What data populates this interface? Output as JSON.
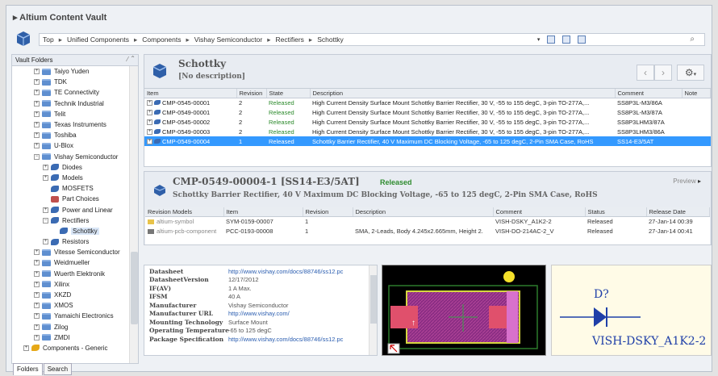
{
  "app": {
    "title": "Altium Content Vault"
  },
  "breadcrumb": [
    "Top",
    "Unified Components",
    "Components",
    "Vishay Semiconductor",
    "Rectifiers",
    "Schottky"
  ],
  "sidebar": {
    "header": "Vault Folders",
    "items": [
      {
        "label": "Taiyo Yuden",
        "icon": "folder-icon",
        "level": 1,
        "exp": "+"
      },
      {
        "label": "TDK",
        "icon": "folder-icon",
        "level": 1,
        "exp": "+"
      },
      {
        "label": "TE Connectivity",
        "icon": "folder-icon",
        "level": 1,
        "exp": "+"
      },
      {
        "label": "Technik Industrial",
        "icon": "folder-icon",
        "level": 1,
        "exp": "+"
      },
      {
        "label": "Telit",
        "icon": "folder-icon",
        "level": 1,
        "exp": "+"
      },
      {
        "label": "Texas Instruments",
        "icon": "folder-icon",
        "level": 1,
        "exp": "+"
      },
      {
        "label": "Toshiba",
        "icon": "folder-icon",
        "level": 1,
        "exp": "+"
      },
      {
        "label": "U-Blox",
        "icon": "folder-icon",
        "level": 1,
        "exp": "+"
      },
      {
        "label": "Vishay Semiconductor",
        "icon": "folder-icon",
        "level": 1,
        "exp": "-"
      },
      {
        "label": "Diodes",
        "icon": "component-icon",
        "level": 2,
        "exp": "+"
      },
      {
        "label": "Models",
        "icon": "component-icon",
        "level": 2,
        "exp": "+"
      },
      {
        "label": "MOSFETS",
        "icon": "component-icon",
        "level": 2,
        "exp": ""
      },
      {
        "label": "Part Choices",
        "icon": "part-choice-icon",
        "level": 2,
        "exp": ""
      },
      {
        "label": "Power and Linear",
        "icon": "component-icon",
        "level": 2,
        "exp": "+"
      },
      {
        "label": "Rectifiers",
        "icon": "component-icon",
        "level": 2,
        "exp": "-"
      },
      {
        "label": "Schottky",
        "icon": "component-icon",
        "level": 3,
        "exp": "",
        "selected": true
      },
      {
        "label": "Resistors",
        "icon": "component-icon",
        "level": 2,
        "exp": "+"
      },
      {
        "label": "Vitesse Semiconductor",
        "icon": "folder-icon",
        "level": 1,
        "exp": "+"
      },
      {
        "label": "Weidmueller",
        "icon": "folder-icon",
        "level": 1,
        "exp": "+"
      },
      {
        "label": "Wuerth Elektronik",
        "icon": "folder-icon",
        "level": 1,
        "exp": "+"
      },
      {
        "label": "Xilinx",
        "icon": "folder-icon",
        "level": 1,
        "exp": "+"
      },
      {
        "label": "XKZD",
        "icon": "folder-icon",
        "level": 1,
        "exp": "+"
      },
      {
        "label": "XMOS",
        "icon": "folder-icon",
        "level": 1,
        "exp": "+"
      },
      {
        "label": "Yamaichi Electronics",
        "icon": "folder-icon",
        "level": 1,
        "exp": "+"
      },
      {
        "label": "Zilog",
        "icon": "folder-icon",
        "level": 1,
        "exp": "+"
      },
      {
        "label": "ZMDI",
        "icon": "folder-icon",
        "level": 1,
        "exp": "+"
      },
      {
        "label": "Components - Generic",
        "icon": "generic-icon",
        "level": 0,
        "exp": "+"
      }
    ],
    "tabs": [
      "Folders",
      "Search"
    ]
  },
  "folder": {
    "title": "Schottky",
    "description": "[No description]"
  },
  "items_table": {
    "columns": [
      "Item",
      "Revision",
      "State",
      "Description",
      "Comment",
      "Note"
    ],
    "rows": [
      {
        "item": "CMP-0545-00001",
        "revision": "2",
        "state": "Released",
        "description": "High Current Density Surface Mount Schottky Barrier Rectifier, 30 V, -55 to 155 degC, 3-pin TO-277A,...",
        "comment": "SS8P3L-M3/86A",
        "note": ""
      },
      {
        "item": "CMP-0549-00001",
        "revision": "2",
        "state": "Released",
        "description": "High Current Density Surface Mount Schottky Barrier Rectifier, 30 V, -55 to 155 degC, 3-pin TO-277A,...",
        "comment": "SS8P3L-M3/87A",
        "note": ""
      },
      {
        "item": "CMP-0545-00002",
        "revision": "2",
        "state": "Released",
        "description": "High Current Density Surface Mount Schottky Barrier Rectifier, 30 V, -55 to 155 degC, 3-pin TO-277A,...",
        "comment": "SS8P3LHM3/87A",
        "note": ""
      },
      {
        "item": "CMP-0549-00003",
        "revision": "2",
        "state": "Released",
        "description": "High Current Density Surface Mount Schottky Barrier Rectifier, 30 V, -55 to 155 degC, 3-pin TO-277A,...",
        "comment": "SS8P3LHM3/86A",
        "note": ""
      },
      {
        "item": "CMP-0549-00004",
        "revision": "1",
        "state": "Released",
        "description": "Schottky Barrier Rectifier, 40 V Maximum DC Blocking Voltage, -65 to 125 degC, 2-Pin SMA Case, RoHS",
        "comment": "SS14-E3/5AT",
        "note": "",
        "selected": true
      }
    ]
  },
  "detail": {
    "title": "CMP-0549-00004-1 [SS14-E3/5AT]",
    "state": "Released",
    "subtitle": "Schottky Barrier Rectifier, 40 V Maximum DC Blocking Voltage, -65 to 125 degC, 2-Pin SMA Case, RoHS",
    "preview_label": "Preview",
    "models_columns": [
      "Revision Models",
      "Item",
      "Revision",
      "Description",
      "Comment",
      "Status",
      "Release Date"
    ],
    "models": [
      {
        "model": "altium-symbol",
        "item": "SYM-0159-00007",
        "revision": "1",
        "description": "",
        "comment": "VISH-DSKY_A1K2-2",
        "status": "Released",
        "date": "27-Jan-14 00:39"
      },
      {
        "model": "altium-pcb-component",
        "item": "PCC-0193-00008",
        "revision": "1",
        "description": "SMA, 2-Leads, Body 4.245x2.665mm, Height 2.",
        "comment": "VISH-DO-214AC-2_V",
        "status": "Released",
        "date": "27-Jan-14 00:41"
      }
    ]
  },
  "properties": [
    {
      "key": "Datasheet",
      "value": "http://www.vishay.com/docs/88746/ss12.pc",
      "link": true
    },
    {
      "key": "DatasheetVersion",
      "value": "12/17/2012",
      "link": false
    },
    {
      "key": "IF(AV)",
      "value": "1 A Max.",
      "link": false
    },
    {
      "key": "IFSM",
      "value": "40 A",
      "link": false
    },
    {
      "key": "Manufacturer",
      "value": "Vishay Semiconductor",
      "link": false
    },
    {
      "key": "Manufacturer URL",
      "value": "http://www.vishay.com/",
      "link": true
    },
    {
      "key": "Mounting Technology",
      "value": "Surface Mount",
      "link": false
    },
    {
      "key": "Operating Temperature",
      "value": "-65 to 125 degC",
      "link": false
    },
    {
      "key": "Package Specification",
      "value": "http://www.vishay.com/docs/88746/ss12.pc",
      "link": true
    }
  ],
  "symbol": {
    "designator": "D?",
    "name": "VISH-DSKY_A1K2-2"
  },
  "colors": {
    "accent": "#3399ff",
    "released": "#2e8b2e",
    "symbol_text": "#1f3fa8"
  }
}
